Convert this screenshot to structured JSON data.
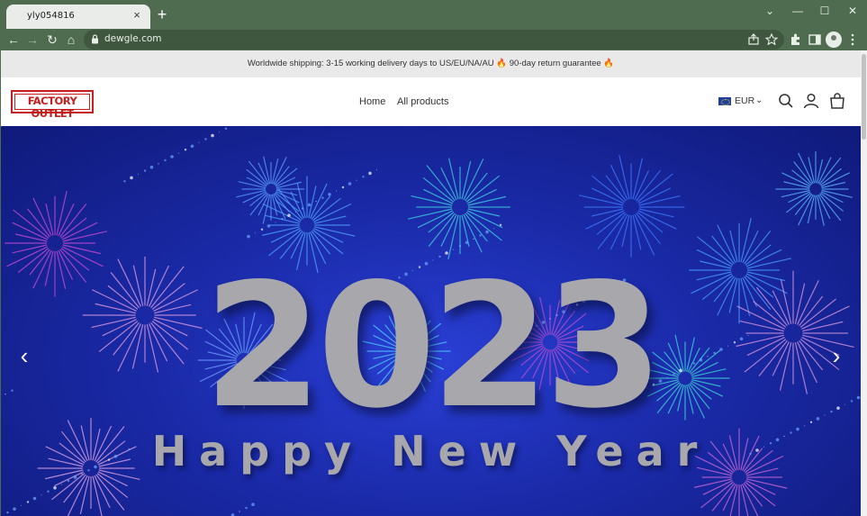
{
  "browser": {
    "tab_title": "yly054816",
    "tab_close": "×",
    "new_tab": "+",
    "url": "dewgle.com",
    "window_controls": {
      "minimize": "—",
      "maximize": "☐",
      "close": "✕",
      "dropdown": "⌄"
    },
    "nav": {
      "back": "←",
      "forward": "→",
      "reload": "↻",
      "home": "⌂"
    }
  },
  "announcement": {
    "text": "Worldwide shipping: 3-15 working delivery days to US/EU/NA/AU 🔥 90-day return guarantee 🔥"
  },
  "header": {
    "logo_text": "FACTORY OUTLET",
    "nav": [
      {
        "label": "Home"
      },
      {
        "label": "All products"
      }
    ],
    "currency": {
      "code": "EUR",
      "chevron": "⌄"
    }
  },
  "hero": {
    "year": "2023",
    "greeting": "Happy New Year",
    "prev": "‹",
    "next": "›"
  },
  "colors": {
    "chrome": "#4f6b50",
    "announcement_bg": "#e9e9e9",
    "logo_red": "#c51f1f",
    "hero_blue": "#1a2aa8",
    "hero_text": "#a8a8ac"
  }
}
